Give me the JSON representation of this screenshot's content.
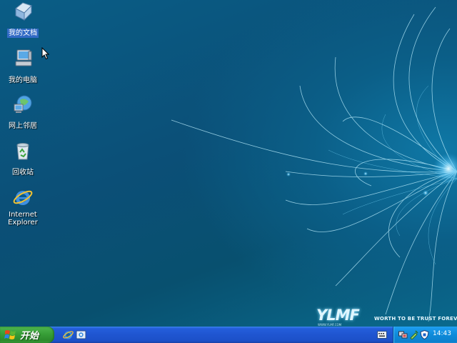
{
  "desktop": {
    "icons": [
      {
        "label": "我的文档",
        "icon": "my-documents-icon",
        "selected": true
      },
      {
        "label": "我的电脑",
        "icon": "my-computer-icon",
        "selected": false
      },
      {
        "label": "网上邻居",
        "icon": "network-places-icon",
        "selected": false
      },
      {
        "label": "回收站",
        "icon": "recycle-bin-icon",
        "selected": false
      },
      {
        "label": "Internet\nExplorer",
        "icon": "internet-explorer-icon",
        "selected": false
      }
    ],
    "wallpaper_brand": {
      "logo": "YLMF",
      "tagline": "WORTH TO BE TRUST FOREVER",
      "url": "WWW.YLMF.COM"
    }
  },
  "taskbar": {
    "start_label": "开始",
    "quick_launch": [
      "internet-explorer-icon",
      "show-desktop-icon"
    ],
    "tray": {
      "icons": [
        "input-method-icon",
        "network-icon",
        "safely-remove-icon",
        "security-shield-icon"
      ],
      "clock": "14:43"
    }
  },
  "colors": {
    "taskbar": "#245edb",
    "start_button": "#379e37",
    "tray": "#0e8ad9",
    "selection": "#316ac5"
  }
}
